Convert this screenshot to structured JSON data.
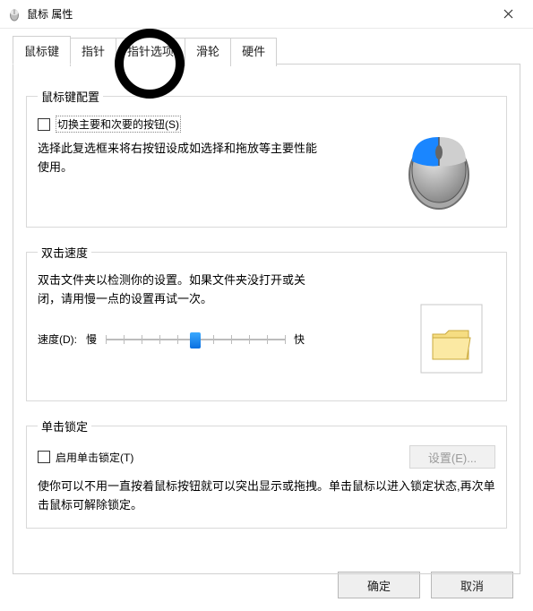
{
  "window": {
    "title": "鼠标 属性"
  },
  "tabs": {
    "buttons": "鼠标键",
    "pointer": "指针",
    "pointerOptions": "指针选项",
    "wheel": "滑轮",
    "hardware": "硬件"
  },
  "group1": {
    "legend": "鼠标键配置",
    "checkboxLabel": "切换主要和次要的按钮(S)",
    "desc": "选择此复选框来将右按钮设成如选择和拖放等主要性能使用。"
  },
  "group2": {
    "legend": "双击速度",
    "desc": "双击文件夹以检测你的设置。如果文件夹没打开或关闭，请用慢一点的设置再试一次。",
    "speedLabel": "速度(D):",
    "slow": "慢",
    "fast": "快"
  },
  "group3": {
    "legend": "单击锁定",
    "checkboxLabel": "启用单击锁定(T)",
    "settingsBtn": "设置(E)...",
    "desc": "使你可以不用一直按着鼠标按钮就可以突出显示或拖拽。单击鼠标以进入锁定状态,再次单击鼠标可解除锁定。"
  },
  "footer": {
    "ok": "确定",
    "cancel": "取消"
  }
}
